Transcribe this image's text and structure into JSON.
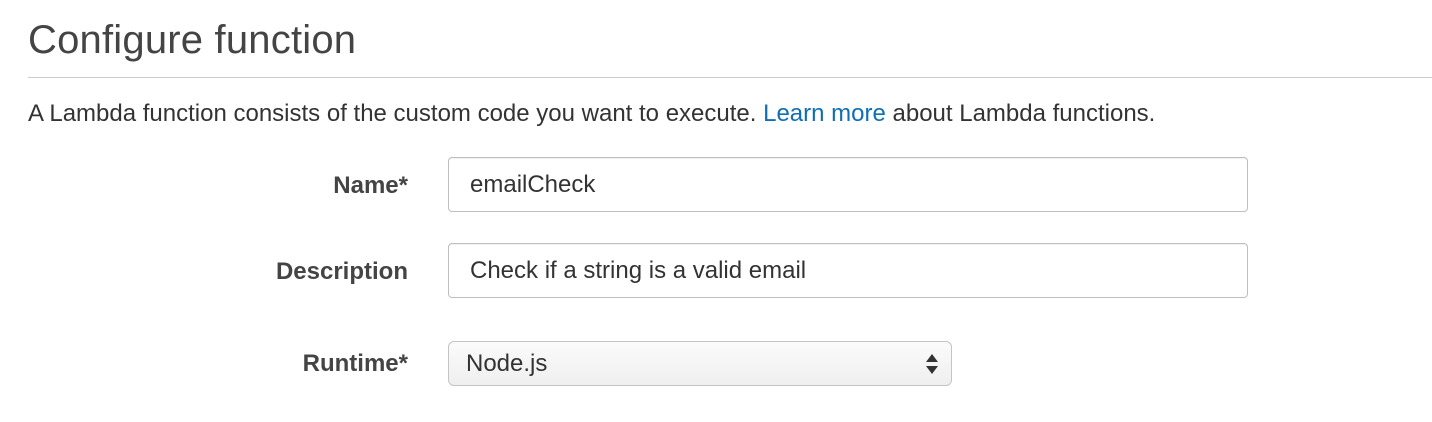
{
  "page": {
    "title": "Configure function"
  },
  "intro": {
    "text_before": "A Lambda function consists of the custom code you want to execute. ",
    "link_text": "Learn more",
    "text_after": " about Lambda functions."
  },
  "form": {
    "name": {
      "label": "Name*",
      "value": "emailCheck"
    },
    "description": {
      "label": "Description",
      "value": "Check if a string is a valid email"
    },
    "runtime": {
      "label": "Runtime*",
      "selected": "Node.js"
    }
  },
  "colors": {
    "link": "#0f6fb5",
    "title": "#444444",
    "text": "#333333",
    "border": "#bfbfbf"
  },
  "icons": {
    "runtime_select": "up-down-arrows-icon"
  }
}
